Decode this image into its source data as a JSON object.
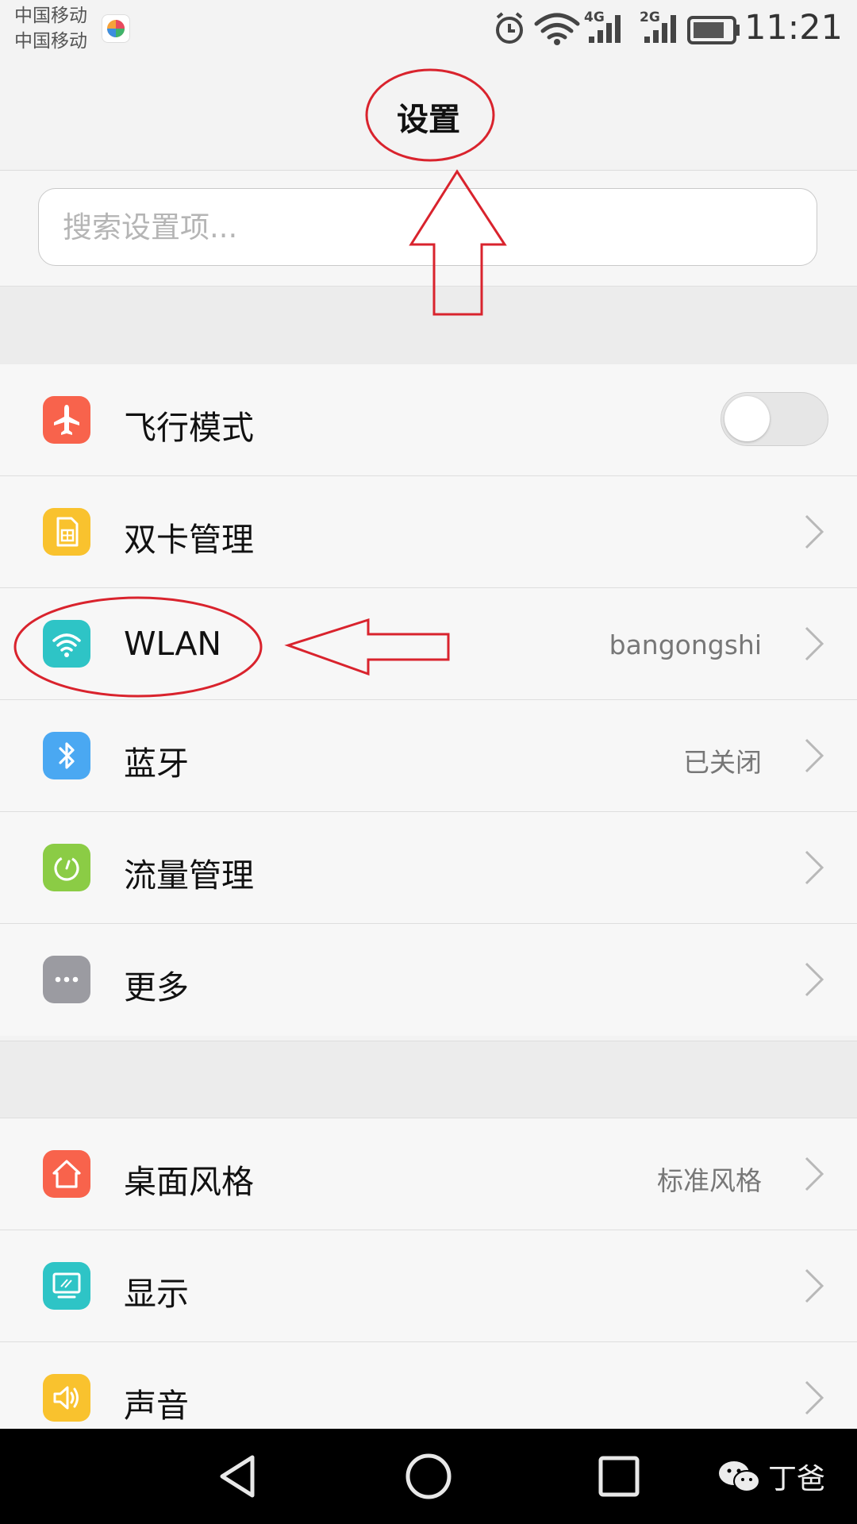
{
  "status_bar": {
    "carrier_1": "中国移动",
    "carrier_2": "中国移动",
    "net_1": "4G",
    "net_2": "2G",
    "time": "11:21"
  },
  "header": {
    "title": "设置"
  },
  "search": {
    "placeholder": "搜索设置项..."
  },
  "group_1": [
    {
      "label": "飞行模式",
      "value": "",
      "control": "toggle",
      "toggle_on": false,
      "icon": "airplane-icon",
      "color": "#f8634c"
    },
    {
      "label": "双卡管理",
      "value": "",
      "control": "chevron",
      "icon": "sim-card-icon",
      "color": "#f9c22e"
    },
    {
      "label": "WLAN",
      "value": "bangongshi",
      "control": "chevron",
      "icon": "wifi-icon",
      "color": "#2ec4c6"
    },
    {
      "label": "蓝牙",
      "value": "已关闭",
      "control": "chevron",
      "icon": "bluetooth-icon",
      "color": "#4aa8f2"
    },
    {
      "label": "流量管理",
      "value": "",
      "control": "chevron",
      "icon": "data-usage-icon",
      "color": "#8bcc45"
    },
    {
      "label": "更多",
      "value": "",
      "control": "chevron",
      "icon": "more-icon",
      "color": "#9b9ba1"
    }
  ],
  "group_2": [
    {
      "label": "桌面风格",
      "value": "标准风格",
      "control": "chevron",
      "icon": "home-icon",
      "color": "#f8634c"
    },
    {
      "label": "显示",
      "value": "",
      "control": "chevron",
      "icon": "display-icon",
      "color": "#2ec4c6"
    },
    {
      "label": "声音",
      "value": "",
      "control": "chevron",
      "icon": "speaker-icon",
      "color": "#f9c22e"
    }
  ],
  "watermark": {
    "text": "丁爸"
  },
  "colors": {
    "annotation": "#d9232d",
    "background": "#f3f3f3",
    "nav_bar": "#000000"
  }
}
